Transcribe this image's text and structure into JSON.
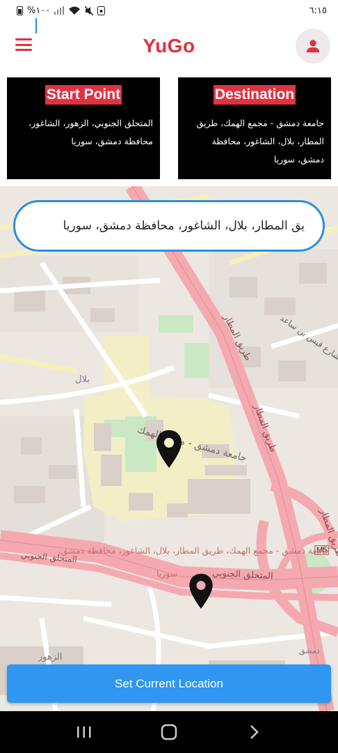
{
  "status_bar": {
    "battery_text": "%١٠٠",
    "time": "٦:١٥",
    "icons": [
      "battery-icon",
      "signal-icon",
      "wifi-icon",
      "mute-icon",
      "photo-icon"
    ]
  },
  "header": {
    "title": "YuGo",
    "menu_icon": "hamburger-menu-icon",
    "profile_icon": "person-icon"
  },
  "start_point": {
    "label": "Start Point",
    "address": "المتحلق الجنوبي، الزهور، الشاغور، محافظة دمشق، سوريا"
  },
  "destination": {
    "label": "Destination",
    "address": "جامعة دمشق - مجمع الهمك، طريق المطار، بلال، الشاغور، محافظة دمشق، سوريا"
  },
  "search": {
    "value": "يق المطار، بلال، الشاغور، محافظة دمشق، سوريا"
  },
  "map": {
    "labels": {
      "airport_road_1": "طريق المطار",
      "airport_road_2": "طريق المطار",
      "airport_road_3": "طريق المطار",
      "street_qais": "شارع قيس بن ساعد",
      "bilal": "بلال",
      "university": "جامعة دمشق - مجمع الهمك",
      "south_ring_1": "المتحلق الجنوبي",
      "south_ring_2": "المتحلق الجنوبي",
      "zuhour": "الزهور",
      "damascus": "دمشق",
      "highway": "M5"
    },
    "marker_label_line1": "جامعة دمشق - مجمع الهمك، طريق المطار، بلال، الشاغور، محافظة دمشق،",
    "marker_label_line2": "سوريا",
    "colors": {
      "primary_road": "#f4a9b0",
      "secondary_road": "#ffffff",
      "park": "#c9e8c3",
      "campus": "#f2efc7",
      "building": "#d9d0c9"
    }
  },
  "actions": {
    "set_location_label": "Set Current Location"
  },
  "nav_bar": {
    "icons": [
      "recents-icon",
      "home-icon",
      "back-icon"
    ]
  },
  "colors": {
    "brand_red": "#e0323f",
    "accent_blue": "#2f96f2",
    "card_bg": "#000000"
  }
}
